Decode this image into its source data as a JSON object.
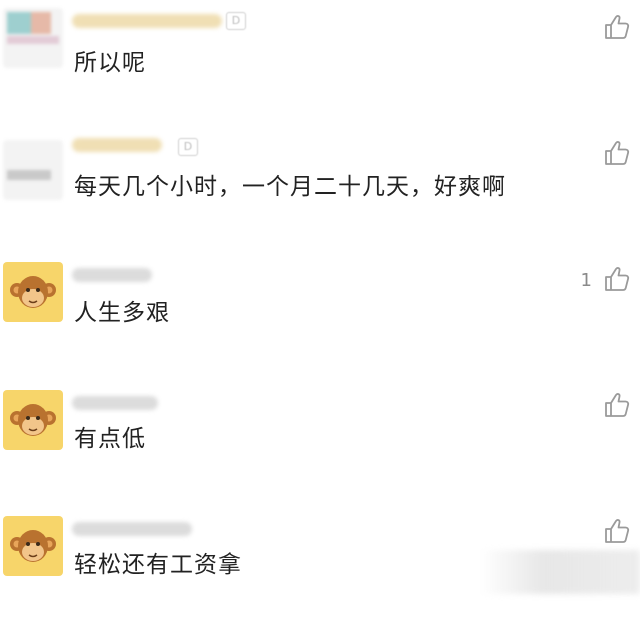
{
  "comments": [
    {
      "text": "所以呢",
      "likes": "",
      "nick_tag": "D"
    },
    {
      "text": "每天几个小时，一个月二十几天，好爽啊",
      "likes": "",
      "nick_tag": "D"
    },
    {
      "text": "人生多艰",
      "likes": "1"
    },
    {
      "text": "有点低",
      "likes": ""
    },
    {
      "text": "轻松还有工资拿",
      "likes": ""
    }
  ],
  "icons": {
    "like": "thumbs-up-icon",
    "avatar": "monkey-avatar"
  },
  "colors": {
    "avatar_bg": "#f7d56a",
    "text": "#222222",
    "icon": "#9a9a9a"
  }
}
